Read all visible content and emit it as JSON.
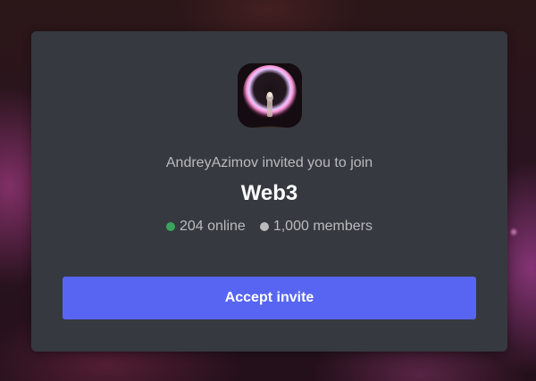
{
  "invite": {
    "inviter_text": "AndreyAzimov invited you to join",
    "server_name": "Web3",
    "online_count": "204 online",
    "member_count": "1,000 members",
    "accept_label": "Accept invite",
    "icon": "server-portal-image"
  },
  "colors": {
    "card_background": "#36393f",
    "accent": "#5865f2",
    "online_dot": "#3ba55d",
    "members_dot": "#b9bbbe"
  }
}
